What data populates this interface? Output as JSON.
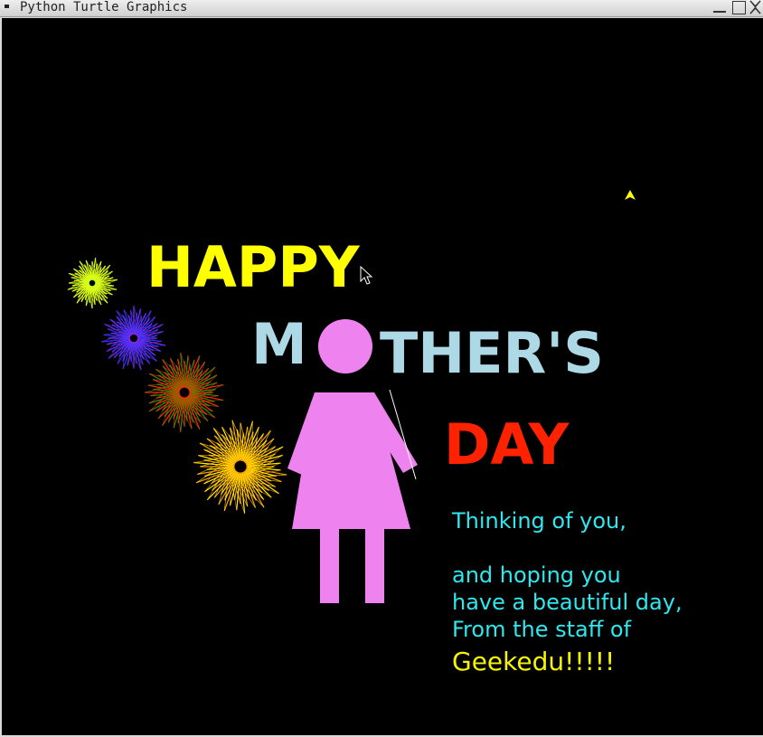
{
  "window": {
    "title": "Python Turtle Graphics",
    "controls": [
      "minimize",
      "maximize",
      "close"
    ]
  },
  "canvas": {
    "background": "#000000",
    "headline": {
      "line1": "HAPPY",
      "line2_start": "M",
      "line2_end": "THER'S",
      "line3": "DAY"
    },
    "message": {
      "line1": "Thinking of you,",
      "line2": "and hoping you",
      "line3": "have a beautiful day,",
      "line4": "From the staff of",
      "signature": "Geekedu!!!!!"
    },
    "colors": {
      "happy": "#ffff00",
      "mothers": "#add8e6",
      "day": "#ff2200",
      "figure": "#ee82ee",
      "message": "#2ee8ee",
      "signature": "#f5f500",
      "turtle": "#ffff00"
    },
    "figure_icon": "woman-figure-icon",
    "turtle_icon": "turtle-arrow-icon",
    "cursor_icon": "mouse-pointer-icon",
    "fireworks": [
      {
        "name": "firework-green",
        "colors": [
          "#b8ff30",
          "#ffff00"
        ]
      },
      {
        "name": "firework-purple",
        "colors": [
          "#8a2be2",
          "#2233ff"
        ]
      },
      {
        "name": "firework-red-green",
        "colors": [
          "#ff2a00",
          "#3a8a00"
        ]
      },
      {
        "name": "firework-orange",
        "colors": [
          "#ff9a00",
          "#ffee00"
        ]
      }
    ]
  }
}
